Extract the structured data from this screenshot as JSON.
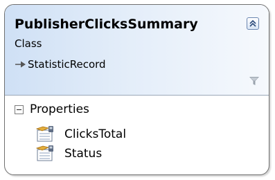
{
  "class_shape": {
    "name": "PublisherClicksSummary",
    "kind": "Class",
    "base_class": "StatisticRecord",
    "sections": [
      {
        "label": "Properties",
        "items": [
          "ClicksTotal",
          "Status"
        ]
      }
    ]
  },
  "colors": {
    "header_gradient_start": "#cfe0f5",
    "header_gradient_end": "#f6f9fd",
    "border": "#6f6f6f"
  }
}
